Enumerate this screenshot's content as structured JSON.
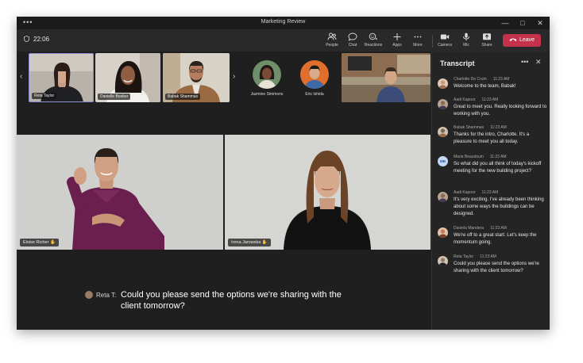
{
  "window": {
    "title": "Marketing Review",
    "menu_glyph": "•••",
    "controls": {
      "minimize": "—",
      "maximize": "□",
      "close": "✕"
    }
  },
  "toolbar": {
    "timer": "22:06",
    "buttons": [
      {
        "label": "People",
        "icon": "people-icon"
      },
      {
        "label": "Chat",
        "icon": "chat-icon"
      },
      {
        "label": "Reactions",
        "icon": "reactions-icon"
      },
      {
        "label": "Apps",
        "icon": "plus-icon"
      },
      {
        "label": "More",
        "icon": "more-icon"
      },
      {
        "label": "Camera",
        "icon": "camera-icon"
      },
      {
        "label": "Mic",
        "icon": "mic-icon"
      },
      {
        "label": "Share",
        "icon": "share-icon"
      }
    ],
    "leave_label": "Leave"
  },
  "gallery": {
    "video_tiles": [
      {
        "name": "Reta Taylor"
      },
      {
        "name": "Danielle Booker"
      },
      {
        "name": "Babak Shammas"
      }
    ],
    "avatar_tiles": [
      {
        "name": "Jazmine Simmons"
      },
      {
        "name": "Eric Ishida"
      }
    ]
  },
  "stage": {
    "tiles": [
      {
        "name": "Eloise Richer"
      },
      {
        "name": "Irena Jarowska"
      }
    ]
  },
  "caption": {
    "speaker": "Reta T:",
    "text": "Could you please send the options we're sharing with the client tomorrow?"
  },
  "transcript": {
    "title": "Transcript",
    "more_glyph": "•••",
    "close_glyph": "✕",
    "entries": [
      {
        "name": "Charlotte De Crum",
        "time": "11:23 AM",
        "text": "Welcome to the team, Babak!",
        "avatar_color": "#c69c7e"
      },
      {
        "name": "Aadi Kapoor",
        "time": "11:23 AM",
        "text": "Great to meet you. Really looking forward to working with you.",
        "avatar_color": "#8a6a52"
      },
      {
        "name": "Babak Shammas",
        "time": "11:23 AM",
        "text": "Thanks for the intro, Charlotte. It's a pleasure to meet you all today.",
        "avatar_color": "#7e6652"
      },
      {
        "name": "Marie Beaudouin",
        "time": "11:23 AM",
        "text": "So what did you all think of today's kickoff meeting for the new building project?",
        "initials": "MB"
      },
      {
        "name": "Aadi Kapoor",
        "time": "11:23 AM",
        "text": "It's very exciting. I've already been thinking about some ways the buildings can be designed.",
        "avatar_color": "#8a6a52"
      },
      {
        "name": "Daniela Mandera",
        "time": "11:23 AM",
        "text": "We're off to a great start. Let's keep the momentum going.",
        "avatar_color": "#c27a5a"
      },
      {
        "name": "Reta Taylor",
        "time": "11:23 AM",
        "text": "Could you please send the options we're sharing with the client tomorrow?",
        "avatar_color": "#9a7a63"
      }
    ]
  }
}
